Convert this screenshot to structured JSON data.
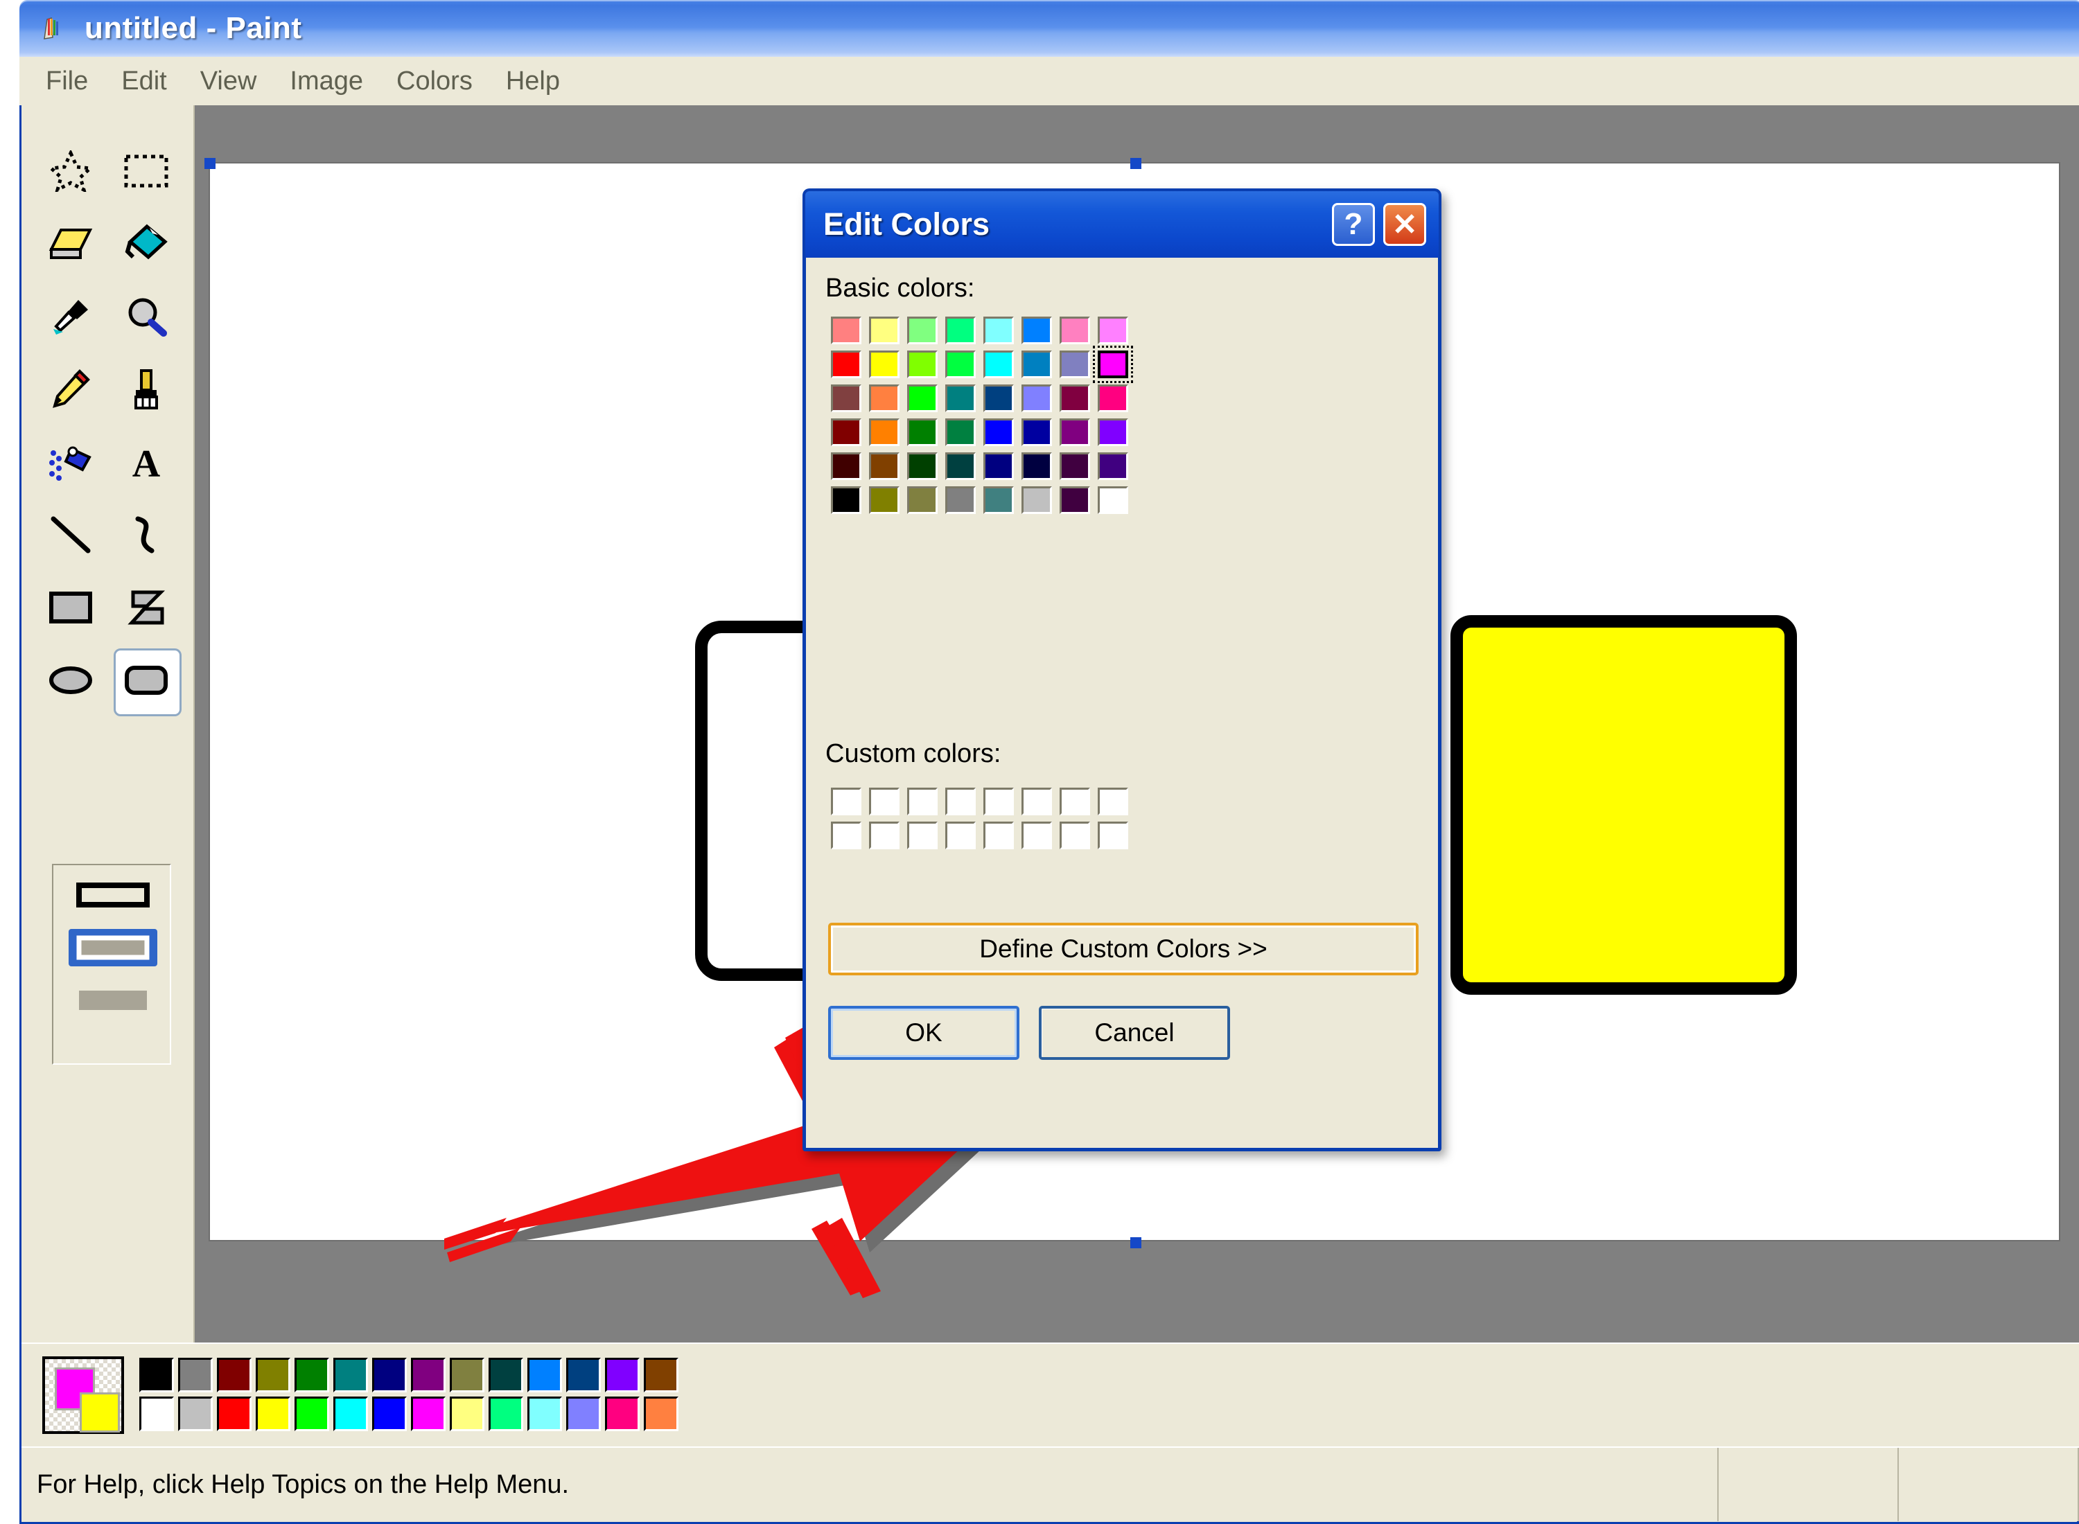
{
  "window": {
    "title": "untitled - Paint",
    "icon": "paint-palette-icon"
  },
  "menu": {
    "items": [
      {
        "label": "File"
      },
      {
        "label": "Edit"
      },
      {
        "label": "View"
      },
      {
        "label": "Image"
      },
      {
        "label": "Colors"
      },
      {
        "label": "Help"
      }
    ]
  },
  "toolbox": {
    "tools": [
      {
        "name": "free-form-select-icon",
        "label": "Free-Form Select",
        "selected": false
      },
      {
        "name": "rectangle-select-icon",
        "label": "Select",
        "selected": false
      },
      {
        "name": "eraser-icon",
        "label": "Eraser/Color Eraser",
        "selected": false
      },
      {
        "name": "fill-with-color-icon",
        "label": "Fill With Color",
        "selected": false
      },
      {
        "name": "pick-color-icon",
        "label": "Pick Color",
        "selected": false
      },
      {
        "name": "magnifier-icon",
        "label": "Magnifier",
        "selected": false
      },
      {
        "name": "pencil-icon",
        "label": "Pencil",
        "selected": false
      },
      {
        "name": "brush-icon",
        "label": "Brush",
        "selected": false
      },
      {
        "name": "airbrush-icon",
        "label": "Airbrush",
        "selected": false
      },
      {
        "name": "text-icon",
        "label": "Text",
        "selected": false
      },
      {
        "name": "line-icon",
        "label": "Line",
        "selected": false
      },
      {
        "name": "curve-icon",
        "label": "Curve",
        "selected": false
      },
      {
        "name": "rectangle-icon",
        "label": "Rectangle",
        "selected": false
      },
      {
        "name": "polygon-icon",
        "label": "Polygon",
        "selected": false
      },
      {
        "name": "ellipse-icon",
        "label": "Ellipse",
        "selected": false
      },
      {
        "name": "rounded-rectangle-icon",
        "label": "Rounded Rectangle",
        "selected": true
      }
    ],
    "fill_options": [
      {
        "name": "outline-only-option",
        "selected": false
      },
      {
        "name": "outline-and-fill-option",
        "selected": true
      },
      {
        "name": "fill-only-option",
        "selected": false
      }
    ]
  },
  "canvas": {
    "shapes": [
      {
        "name": "rounded-rectangle-outline",
        "fill": "none",
        "stroke": "#000000"
      },
      {
        "name": "rounded-rectangle-yellow",
        "fill": "#ffff00",
        "stroke": "#000000"
      }
    ],
    "annotation": {
      "name": "red-arrow-annotation",
      "color": "#ee1111",
      "points_to": "Define Custom Colors >>"
    }
  },
  "palette": {
    "foreground": "#ff00ff",
    "background": "#ffff00",
    "row_top": [
      "#000000",
      "#808080",
      "#800000",
      "#808000",
      "#008000",
      "#008080",
      "#000080",
      "#800080",
      "#808040",
      "#004040",
      "#0080ff",
      "#004080",
      "#8000ff",
      "#804000"
    ],
    "row_bottom": [
      "#ffffff",
      "#c0c0c0",
      "#ff0000",
      "#ffff00",
      "#00ff00",
      "#00ffff",
      "#0000ff",
      "#ff00ff",
      "#ffff80",
      "#00ff80",
      "#80ffff",
      "#8080ff",
      "#ff0080",
      "#ff8040"
    ]
  },
  "status": {
    "text": "For Help, click Help Topics on the Help Menu."
  },
  "dialog": {
    "title": "Edit Colors",
    "help_button": "?",
    "close_button": "✕",
    "basic_colors_label": "Basic colors:",
    "custom_colors_label": "Custom colors:",
    "basic_colors": [
      "#ff8080",
      "#ffff80",
      "#80ff80",
      "#00ff80",
      "#80ffff",
      "#0080ff",
      "#ff80c0",
      "#ff80ff",
      "#ff0000",
      "#ffff00",
      "#80ff00",
      "#00ff40",
      "#00ffff",
      "#0080c0",
      "#8080c0",
      "#ff00ff",
      "#804040",
      "#ff8040",
      "#00ff00",
      "#008080",
      "#004080",
      "#8080ff",
      "#800040",
      "#ff0080",
      "#800000",
      "#ff8000",
      "#008000",
      "#008040",
      "#0000ff",
      "#0000a0",
      "#800080",
      "#8000ff",
      "#400000",
      "#804000",
      "#004000",
      "#004040",
      "#000080",
      "#000040",
      "#400040",
      "#400080",
      "#000000",
      "#808000",
      "#808040",
      "#808080",
      "#408080",
      "#c0c0c0",
      "#400040",
      "#ffffff"
    ],
    "selected_basic_index": 15,
    "custom_colors": [
      "#ffffff",
      "#ffffff",
      "#ffffff",
      "#ffffff",
      "#ffffff",
      "#ffffff",
      "#ffffff",
      "#ffffff",
      "#ffffff",
      "#ffffff",
      "#ffffff",
      "#ffffff",
      "#ffffff",
      "#ffffff",
      "#ffffff",
      "#ffffff"
    ],
    "define_custom_colors_label": "Define Custom Colors >>",
    "ok_label": "OK",
    "cancel_label": "Cancel"
  }
}
